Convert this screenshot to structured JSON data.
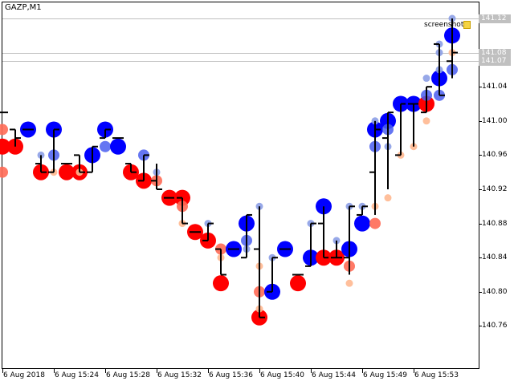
{
  "header": {
    "title": "GAZP,M1",
    "object_label": "screenshot",
    "object_icon": "note-icon"
  },
  "colors": {
    "bull": "#0000ff",
    "bear": "#ff0000",
    "bull_light": "#4a5ef0",
    "bull_faint": "#8c9ee6",
    "bear_light": "#ff6a55",
    "bear_faint": "#ffb890",
    "grid": "#c0c0c0"
  },
  "chart_data": {
    "type": "scatter",
    "symbol": "GAZP",
    "timeframe": "M1",
    "ylim": [
      140.72,
      141.14
    ],
    "yticks": [
      "141.04",
      "141.00",
      "140.96",
      "140.92",
      "140.88",
      "140.84",
      "140.80",
      "140.76"
    ],
    "price_tags": [
      "141.12",
      "141.08",
      "141.07"
    ],
    "xticks": [
      "6 Aug 2018",
      "6 Aug 15:24",
      "6 Aug 15:28",
      "6 Aug 15:32",
      "6 Aug 15:36",
      "6 Aug 15:40",
      "6 Aug 15:44",
      "6 Aug 15:49",
      "6 Aug 15:53"
    ],
    "bars": [
      {
        "c": [
          [
            140.97,
            "R"
          ],
          [
            140.99,
            "r"
          ],
          [
            140.94,
            "r"
          ]
        ],
        "b": [
          141.01,
          141.01,
          141.01,
          141.01
        ]
      },
      {
        "c": [
          [
            140.97,
            "R"
          ]
        ],
        "b": [
          140.99,
          140.97,
          140.99,
          140.98
        ]
      },
      {
        "c": [
          [
            140.99,
            "B"
          ]
        ],
        "b": [
          140.99,
          140.99,
          140.99,
          140.99
        ]
      },
      {
        "c": [
          [
            140.94,
            "R"
          ],
          [
            140.96,
            "s"
          ]
        ],
        "b": [
          140.96,
          140.94,
          140.95,
          140.94
        ]
      },
      {
        "c": [
          [
            140.99,
            "B"
          ],
          [
            140.96,
            "b"
          ],
          [
            140.94,
            "p"
          ]
        ],
        "b": [
          140.99,
          140.94,
          140.94,
          140.99
        ]
      },
      {
        "c": [
          [
            140.94,
            "R"
          ]
        ],
        "b": [
          140.95,
          140.95,
          140.95,
          140.95
        ]
      },
      {
        "c": [
          [
            140.94,
            "R"
          ],
          [
            140.94,
            "p"
          ]
        ],
        "b": [
          140.96,
          140.94,
          140.96,
          140.94
        ]
      },
      {
        "c": [
          [
            140.96,
            "B"
          ]
        ],
        "b": [
          140.97,
          140.94,
          140.94,
          140.97
        ]
      },
      {
        "c": [
          [
            140.99,
            "B"
          ],
          [
            140.97,
            "b"
          ]
        ],
        "b": [
          140.99,
          140.98,
          140.98,
          140.99
        ]
      },
      {
        "c": [
          [
            140.97,
            "B"
          ]
        ],
        "b": [
          140.98,
          140.98,
          140.98,
          140.98
        ]
      },
      {
        "c": [
          [
            140.94,
            "R"
          ]
        ],
        "b": [
          140.95,
          140.94,
          140.95,
          140.94
        ]
      },
      {
        "c": [
          [
            140.93,
            "R"
          ],
          [
            140.96,
            "b"
          ]
        ],
        "b": [
          140.96,
          140.93,
          140.93,
          140.96
        ]
      },
      {
        "c": [
          [
            140.93,
            "r"
          ],
          [
            140.94,
            "s"
          ]
        ],
        "b": [
          140.95,
          140.92,
          140.93,
          140.92
        ]
      },
      {
        "c": [
          [
            140.91,
            "R"
          ]
        ],
        "b": [
          140.91,
          140.91,
          140.91,
          140.91
        ]
      },
      {
        "c": [
          [
            140.91,
            "R"
          ],
          [
            140.9,
            "r"
          ],
          [
            140.88,
            "p"
          ]
        ],
        "b": [
          140.91,
          140.88,
          140.91,
          140.88
        ]
      },
      {
        "c": [
          [
            140.87,
            "R"
          ]
        ],
        "b": [
          140.87,
          140.87,
          140.87,
          140.87
        ]
      },
      {
        "c": [
          [
            140.86,
            "R"
          ],
          [
            140.88,
            "s"
          ]
        ],
        "b": [
          140.88,
          140.86,
          140.86,
          140.88
        ]
      },
      {
        "c": [
          [
            140.85,
            "r"
          ],
          [
            140.84,
            "p"
          ],
          [
            140.81,
            "R"
          ]
        ],
        "b": [
          140.85,
          140.82,
          140.85,
          140.82
        ]
      },
      {
        "c": [
          [
            140.85,
            "B"
          ]
        ],
        "b": [
          140.85,
          140.85,
          140.85,
          140.85
        ]
      },
      {
        "c": [
          [
            140.88,
            "B"
          ],
          [
            140.86,
            "b"
          ],
          [
            140.85,
            "s"
          ]
        ],
        "b": [
          140.89,
          140.84,
          140.84,
          140.89
        ]
      },
      {
        "c": [
          [
            140.9,
            "s"
          ],
          [
            140.83,
            "p"
          ],
          [
            140.8,
            "r"
          ],
          [
            140.78,
            "p"
          ],
          [
            140.77,
            "R"
          ]
        ],
        "b": [
          140.9,
          140.77,
          140.85,
          140.77
        ]
      },
      {
        "c": [
          [
            140.8,
            "B"
          ],
          [
            140.84,
            "s"
          ]
        ],
        "b": [
          140.84,
          140.8,
          140.8,
          140.84
        ]
      },
      {
        "c": [
          [
            140.85,
            "B"
          ]
        ],
        "b": [
          140.85,
          140.85,
          140.85,
          140.85
        ]
      },
      {
        "c": [
          [
            140.81,
            "R"
          ]
        ],
        "b": [
          140.82,
          140.82,
          140.82,
          140.82
        ]
      },
      {
        "c": [
          [
            140.84,
            "B"
          ],
          [
            140.88,
            "s"
          ]
        ],
        "b": [
          140.88,
          140.83,
          140.83,
          140.88
        ]
      },
      {
        "c": [
          [
            140.9,
            "B"
          ],
          [
            140.84,
            "R"
          ]
        ],
        "b": [
          140.9,
          140.84,
          140.88,
          140.84
        ]
      },
      {
        "c": [
          [
            140.84,
            "R"
          ],
          [
            140.86,
            "s"
          ]
        ],
        "b": [
          140.86,
          140.84,
          140.84,
          140.84
        ]
      },
      {
        "c": [
          [
            140.85,
            "B"
          ],
          [
            140.83,
            "r"
          ],
          [
            140.81,
            "p"
          ],
          [
            140.9,
            "s"
          ]
        ],
        "b": [
          140.9,
          140.82,
          140.84,
          140.9
        ]
      },
      {
        "c": [
          [
            140.88,
            "B"
          ],
          [
            140.9,
            "s"
          ]
        ],
        "b": [
          140.9,
          140.89,
          140.89,
          140.9
        ]
      },
      {
        "c": [
          [
            140.88,
            "r"
          ],
          [
            140.9,
            "p"
          ],
          [
            140.99,
            "B"
          ],
          [
            140.97,
            "b"
          ],
          [
            141.0,
            "s"
          ]
        ],
        "b": [
          141.0,
          140.89,
          140.94,
          140.99
        ]
      },
      {
        "c": [
          [
            141.0,
            "B"
          ],
          [
            140.99,
            "b"
          ],
          [
            140.97,
            "s"
          ],
          [
            140.91,
            "p"
          ]
        ],
        "b": [
          141.01,
          140.92,
          140.98,
          141.01
        ]
      },
      {
        "c": [
          [
            141.02,
            "B"
          ],
          [
            140.96,
            "p"
          ]
        ],
        "b": [
          141.02,
          140.96,
          140.96,
          141.02
        ]
      },
      {
        "c": [
          [
            141.02,
            "B"
          ],
          [
            140.97,
            "p"
          ]
        ],
        "b": [
          141.02,
          140.97,
          141.02,
          141.02
        ]
      },
      {
        "c": [
          [
            141.02,
            "R"
          ],
          [
            141.03,
            "b"
          ],
          [
            141.05,
            "s"
          ],
          [
            141.0,
            "p"
          ]
        ],
        "b": [
          141.04,
          141.01,
          141.01,
          141.04
        ]
      },
      {
        "c": [
          [
            141.05,
            "B"
          ],
          [
            141.03,
            "b"
          ],
          [
            141.06,
            "s"
          ],
          [
            141.08,
            "s"
          ],
          [
            141.09,
            "s"
          ]
        ],
        "b": [
          141.09,
          141.03,
          141.09,
          141.03
        ]
      },
      {
        "c": [
          [
            141.1,
            "B"
          ],
          [
            141.08,
            "p"
          ],
          [
            141.06,
            "b"
          ],
          [
            141.12,
            "s"
          ]
        ],
        "b": [
          141.12,
          141.05,
          141.07,
          141.08
        ]
      }
    ]
  }
}
